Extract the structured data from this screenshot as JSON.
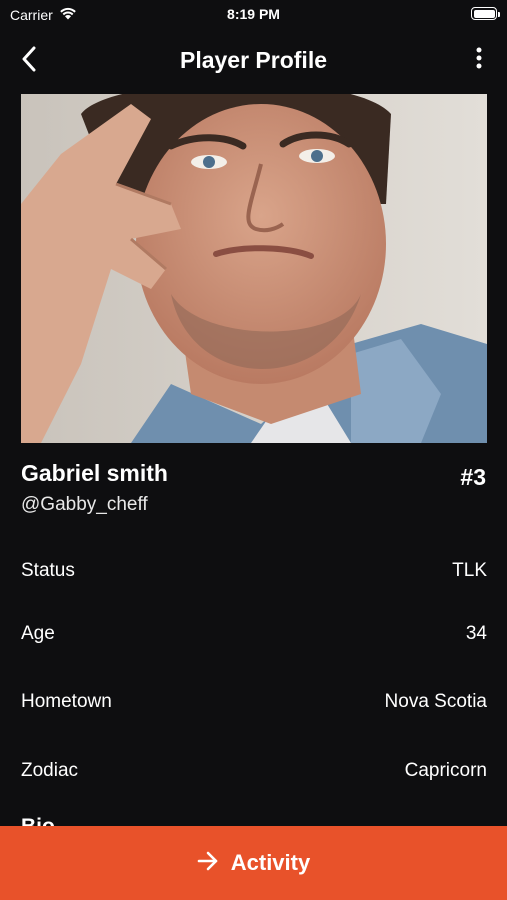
{
  "status_bar": {
    "carrier": "Carrier",
    "time": "8:19 PM"
  },
  "nav": {
    "title": "Player Profile"
  },
  "player": {
    "name": "Gabriel smith",
    "handle": "@Gabby_cheff",
    "rank": "#3"
  },
  "details": [
    {
      "label": "Status",
      "value": "TLK"
    },
    {
      "label": "Age",
      "value": "34"
    },
    {
      "label": "Hometown",
      "value": "Nova Scotia"
    },
    {
      "label": "Zodiac",
      "value": "Capricorn"
    }
  ],
  "bio_peek": "Bio",
  "activity_button": {
    "label": "Activity"
  },
  "colors": {
    "background": "#0e0e10",
    "accent": "#e8522a"
  }
}
